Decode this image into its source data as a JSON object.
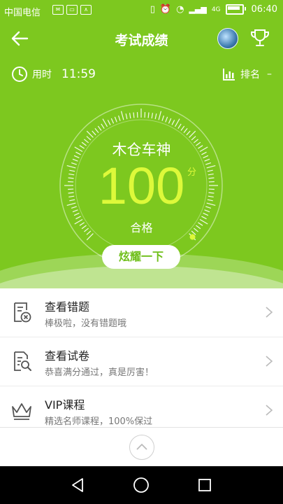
{
  "status_bar": {
    "carrier": "中国电信",
    "time": "06:40",
    "signal": "4G"
  },
  "header": {
    "title": "考试成绩"
  },
  "stats": {
    "time_label": "用时",
    "time_value": "11:59",
    "rank_label": "排名",
    "rank_value": "–"
  },
  "result": {
    "user_name": "木仓车神",
    "score": "100",
    "unit": "分",
    "grade": "合格",
    "score_fraction": 1.0
  },
  "show_button": {
    "label": "炫耀一下"
  },
  "menu": {
    "items": [
      {
        "title": "查看错题",
        "subtitle": "棒极啦，没有错题哦",
        "icon": "wrong-questions-icon"
      },
      {
        "title": "查看试卷",
        "subtitle": "恭喜满分通过，真是厉害！",
        "icon": "view-paper-icon"
      },
      {
        "title": "VIP课程",
        "subtitle": "精选名师课程，100%保过",
        "icon": "crown-icon"
      }
    ]
  },
  "colors": {
    "primary_green": "#7dc81f",
    "score_yellow": "#ddf93a"
  }
}
